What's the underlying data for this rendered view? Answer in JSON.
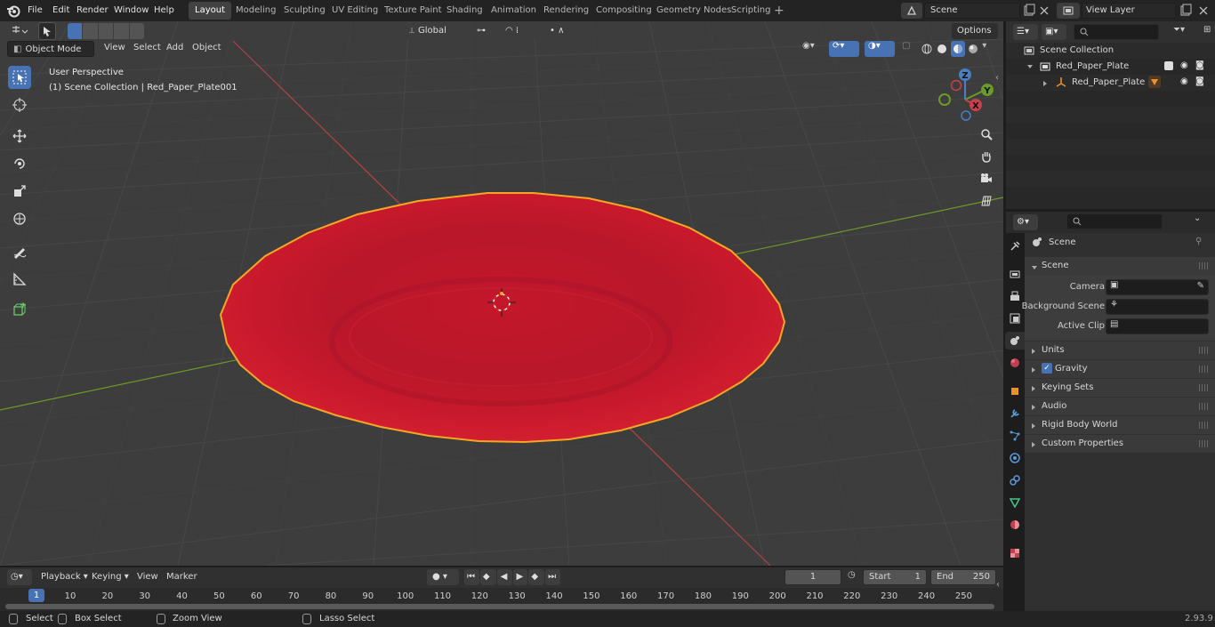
{
  "app": {
    "version": "2.93.9"
  },
  "menu": [
    "File",
    "Edit",
    "Render",
    "Window",
    "Help"
  ],
  "workspaces": [
    "Layout",
    "Modeling",
    "Sculpting",
    "UV Editing",
    "Texture Paint",
    "Shading",
    "Animation",
    "Rendering",
    "Compositing",
    "Geometry Nodes",
    "Scripting"
  ],
  "active_workspace": "Layout",
  "scene_selector": {
    "value": "Scene"
  },
  "view_layer_selector": {
    "value": "View Layer"
  },
  "viewport": {
    "mode": "Object Mode",
    "menus": [
      "View",
      "Select",
      "Add",
      "Object"
    ],
    "transform_orientation": "Global",
    "options_label": "Options",
    "perspective_label": "User Perspective",
    "collection_label": "(1) Scene Collection | Red_Paper_Plate001",
    "gizmo_axes": {
      "x": "X",
      "y": "Y",
      "z": "Z"
    },
    "colors": {
      "plate": "#c8182a",
      "outline": "#f5a623",
      "x_axis": "#b5404a",
      "y_axis": "#6a9a2a",
      "bg": "#3d3d3d"
    }
  },
  "outliner": {
    "root": "Scene Collection",
    "items": [
      {
        "label": "Red_Paper_Plate",
        "level": 1
      },
      {
        "label": "Red_Paper_Plate",
        "level": 2
      }
    ]
  },
  "properties": {
    "context_label": "Scene",
    "panel_title": "Scene",
    "fields": [
      {
        "label": "Camera"
      },
      {
        "label": "Background Scene"
      },
      {
        "label": "Active Clip"
      }
    ],
    "subpanels": [
      "Units",
      "Gravity",
      "Keying Sets",
      "Audio",
      "Rigid Body World",
      "Custom Properties"
    ]
  },
  "timeline": {
    "menus": [
      "Playback",
      "Keying",
      "View",
      "Marker"
    ],
    "current_frame": "1",
    "start_label": "Start",
    "start_value": "1",
    "end_label": "End",
    "end_value": "250",
    "ticks": [
      "10",
      "20",
      "30",
      "40",
      "50",
      "60",
      "70",
      "80",
      "90",
      "100",
      "110",
      "120",
      "130",
      "140",
      "150",
      "160",
      "170",
      "180",
      "190",
      "200",
      "210",
      "220",
      "230",
      "240",
      "250"
    ],
    "playhead": "1"
  },
  "statusbar": {
    "select": "Select",
    "box_select": "Box Select",
    "zoom_view": "Zoom View",
    "lasso_select": "Lasso Select"
  }
}
